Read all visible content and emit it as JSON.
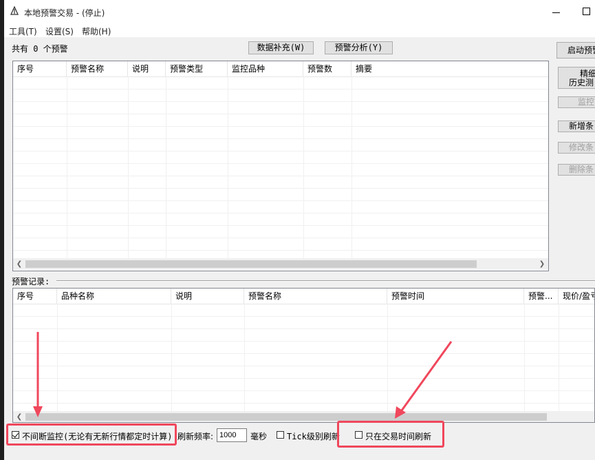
{
  "window": {
    "title": "本地预警交易  -  (停止)"
  },
  "menu": [
    "工具(T)",
    "设置(S)",
    "帮助(H)"
  ],
  "top": {
    "count_label": "共有 0 个预警",
    "btn_supplement": "数据补充(W)",
    "btn_analysis": "预警分析(Y)"
  },
  "alerts_table": {
    "columns": [
      "序号",
      "预警名称",
      "说明",
      "预警类型",
      "监控品种",
      "预警数",
      "摘要"
    ]
  },
  "records": {
    "label": "预警记录:",
    "columns": [
      "序号",
      "品种名称",
      "说明",
      "预警名称",
      "预警时间",
      "预警...",
      "现价/盈亏"
    ]
  },
  "side_buttons": {
    "start": "启动预警",
    "precise_line1": "精细",
    "precise_line2": "历史测",
    "monitor": "监控",
    "add": "新增条",
    "edit": "修改条",
    "delete": "删除条"
  },
  "bottom": {
    "continuous_label": "不间断监控(无论有无新行情都定时计算)",
    "continuous_checked": true,
    "freq_label": "刷新频率:",
    "freq_value": "1000",
    "ms_label": "毫秒",
    "tick_label": "Tick级别刷新",
    "tick_checked": false,
    "trade_time_label": "只在交易时间刷新",
    "trade_time_checked": false
  },
  "colors": {
    "highlight": "#f0475c"
  }
}
